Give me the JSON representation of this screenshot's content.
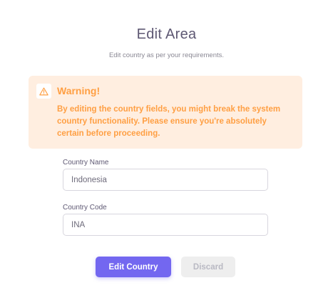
{
  "header": {
    "title": "Edit Area",
    "subtitle": "Edit country as per your requirements."
  },
  "warning": {
    "icon": "alert-triangle-icon",
    "title": "Warning!",
    "message": "By editing the country fields, you might break the system country functionality. Please ensure you're absolutely certain before proceeding.",
    "color": "#ff9f43",
    "background": "#ffeee0"
  },
  "form": {
    "country_name": {
      "label": "Country Name",
      "value": "Indonesia"
    },
    "country_code": {
      "label": "Country Code",
      "value": "INA"
    }
  },
  "actions": {
    "submit_label": "Edit Country",
    "discard_label": "Discard",
    "primary_color": "#7367f0"
  }
}
